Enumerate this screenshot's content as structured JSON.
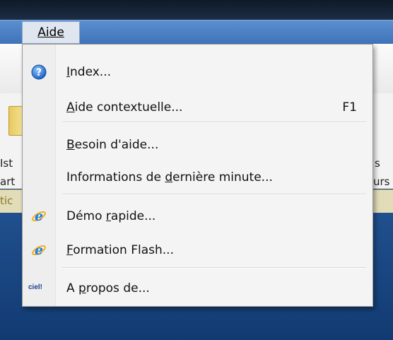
{
  "menubar": {
    "active_menu": "Aide"
  },
  "background": {
    "left_labels": [
      "Ist",
      "art"
    ],
    "right_labels": [
      "s",
      "urs"
    ],
    "status_left": "tic"
  },
  "menu": {
    "items": [
      {
        "label_pre": "",
        "label_ul": "I",
        "label_post": "ndex...",
        "shortcut": "",
        "icon": "help-question-icon"
      },
      {
        "label_pre": "",
        "label_ul": "A",
        "label_post": "ide contextuelle...",
        "shortcut": "F1",
        "icon": ""
      },
      {
        "label_pre": "",
        "label_ul": "B",
        "label_post": "esoin d'aide...",
        "shortcut": "",
        "icon": ""
      },
      {
        "label_pre": "Informations de ",
        "label_ul": "d",
        "label_post": "ernière minute...",
        "shortcut": "",
        "icon": ""
      },
      {
        "label_pre": "Démo ",
        "label_ul": "r",
        "label_post": "apide...",
        "shortcut": "",
        "icon": "internet-explorer-icon"
      },
      {
        "label_pre": "",
        "label_ul": "F",
        "label_post": "ormation Flash...",
        "shortcut": "",
        "icon": "internet-explorer-icon"
      },
      {
        "label_pre": "A ",
        "label_ul": "p",
        "label_post": "ropos de...",
        "shortcut": "",
        "icon": "ciel-logo-icon"
      }
    ]
  },
  "brand": {
    "logo_text": "ciel!"
  },
  "colors": {
    "menubar": "#3f72b8",
    "menu_bg": "#f4f4f4",
    "desktop": "#123a72"
  }
}
